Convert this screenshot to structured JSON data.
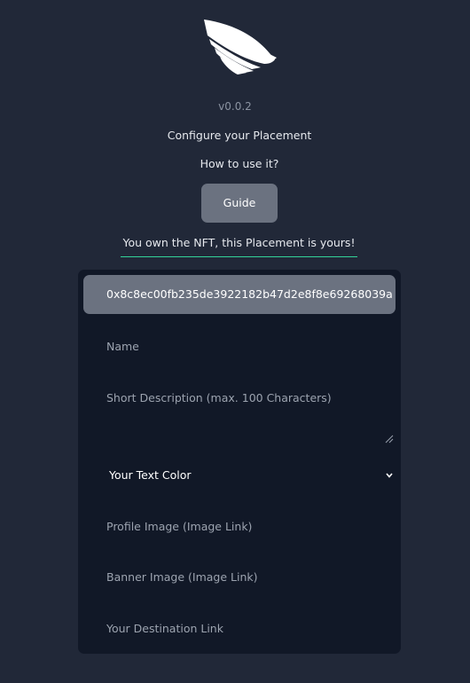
{
  "header": {
    "version": "v0.0.2",
    "title": "Configure your Placement",
    "subtitle": "How to use it?",
    "guide_label": "Guide",
    "ownership_message": "You own the NFT, this Placement is yours!"
  },
  "form": {
    "address": "0x8c8ec00fb235de3922182b47d2e8f8e69268039a",
    "name_placeholder": "Name",
    "description_placeholder": "Short Description (max. 100 Characters)",
    "text_color_label": "Your Text Color",
    "profile_image_placeholder": "Profile Image (Image Link)",
    "banner_image_placeholder": "Banner Image (Image Link)",
    "destination_placeholder": "Your Destination Link"
  },
  "colors": {
    "background": "#212838",
    "panel": "#111827",
    "button": "#6b7280",
    "accent_underline": "#34d399"
  },
  "icons": {
    "logo": "wing-logo",
    "select": "chevron-down-icon",
    "resize": "resize-handle-icon"
  }
}
